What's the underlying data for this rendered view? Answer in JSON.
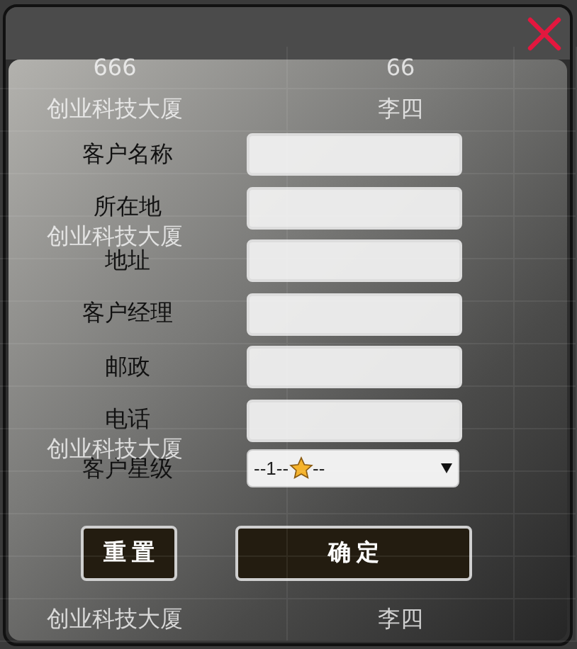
{
  "background_table": {
    "rows": [
      {
        "column_1": "666",
        "column_2": "66"
      },
      {
        "column_1": "创业科技大厦",
        "column_2": "李四"
      },
      {},
      {},
      {
        "column_1": "创业科技大厦"
      },
      {},
      {},
      {},
      {},
      {
        "column_1": "创业科技大厦"
      },
      {},
      {},
      {},
      {
        "column_1": "创业科技大厦",
        "column_2": "李四"
      }
    ]
  },
  "dialog": {
    "fields": [
      {
        "label": "客户名称",
        "kind": "text"
      },
      {
        "label": "所在地",
        "kind": "text"
      },
      {
        "label": "地址",
        "kind": "text"
      },
      {
        "label": "客户经理",
        "kind": "text"
      },
      {
        "label": "邮政",
        "kind": "text"
      },
      {
        "label": "电话",
        "kind": "text"
      },
      {
        "label": "客户星级",
        "kind": "select",
        "value_start": "--1--",
        "value_end": "--"
      }
    ],
    "buttons": [
      {
        "label": "重置",
        "kind": "reset"
      },
      {
        "label": "确定",
        "kind": "submit"
      }
    ]
  }
}
